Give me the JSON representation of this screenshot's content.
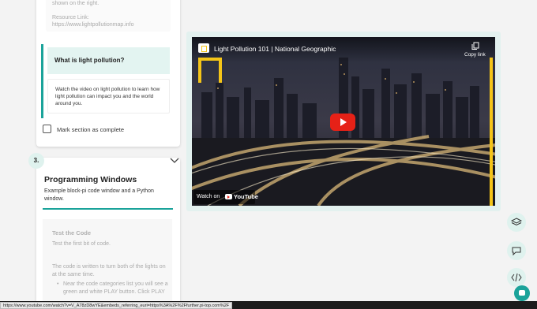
{
  "resource": {
    "line1": "shown on the right.",
    "link_label": "Resource Link:",
    "link_url": "https://www.lightpollutionmap.info"
  },
  "light_pollution": {
    "heading": "What is light pollution?",
    "body": "Watch the video on light pollution to learn how light pollution can impact you and the world around you."
  },
  "mark_complete": {
    "label": "Mark section as complete"
  },
  "programming_windows": {
    "step": "3.",
    "title": "Programming Windows",
    "description": "Example block-pi code window and a Python window."
  },
  "test_code": {
    "title": "Test the Code",
    "subtitle": "Test the first bit of code.",
    "line1": "The code is written to turn both of the lights on at the same time.",
    "bullet1": "Near the code categories list you will see a green and white PLAY button. Click PLAY"
  },
  "video": {
    "title": "Light Pollution 101 | National Geographic",
    "copy_link": "Copy link",
    "watch_on": "Watch on",
    "youtube": "YouTube"
  },
  "status_url": "https://www.youtube.com/watch?v=V_A78zD8wYE&embeds_referring_euri=https%3A%2F%2Ffurther.pi-top.com%2F",
  "colors": {
    "accent": "#1aa39a",
    "accent_light": "#dff2ee",
    "ng_yellow": "#f5c518",
    "yt_red": "#e62117"
  }
}
